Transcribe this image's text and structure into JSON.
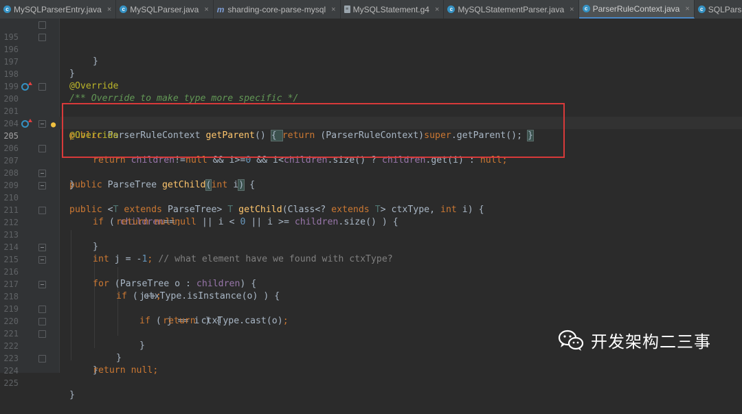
{
  "tabs": [
    {
      "label": "MySQLParserEntry.java",
      "icon": "class-icon",
      "active": false
    },
    {
      "label": "MySQLParser.java",
      "icon": "class-icon",
      "active": false
    },
    {
      "label": "sharding-core-parse-mysql",
      "icon": "maven-module-icon",
      "active": false
    },
    {
      "label": "MySQLStatement.g4",
      "icon": "grammar-file-icon",
      "active": false
    },
    {
      "label": "MySQLStatementParser.java",
      "icon": "class-icon",
      "active": false
    },
    {
      "label": "ParserRuleContext.java",
      "icon": "class-icon",
      "active": true
    },
    {
      "label": "SQLParserEngine.java",
      "icon": "class-icon",
      "active": false
    }
  ],
  "tab_close_glyph": "×",
  "line_numbers": [
    "195",
    "196",
    "197",
    "198",
    "199",
    "200",
    "201",
    "204",
    "205",
    "206",
    "207",
    "208",
    "209",
    "210",
    "211",
    "212",
    "213",
    "214",
    "215",
    "216",
    "217",
    "218",
    "219",
    "220",
    "221",
    "222",
    "223",
    "224",
    "225"
  ],
  "code": {
    "l195": "}",
    "l196": "}",
    "l198": "@Override",
    "l199": "/** Override to make type more specific */",
    "l200_a": "public",
    "l200_b": " ParserRuleContext ",
    "l200_c": "getParent",
    "l200_d": "() ",
    "l200_e": "{ ",
    "l200_f": "return",
    "l200_g": " (ParserRuleContext)",
    "l200_h": "super",
    "l200_i": ".getParent(); ",
    "l200_j": "}",
    "l204": "@Override",
    "l205_a": "public",
    "l205_b": " ParseTree ",
    "l205_c": "getChild",
    "l205_d": "(",
    "l205_e": "int",
    "l205_f": " i",
    "l205_g": ")",
    "l205_h": " {",
    "l206_a": "return ",
    "l206_b": "children",
    "l206_c": "!=",
    "l206_d": "null",
    "l206_e": " && i>=",
    "l206_f": "0",
    "l206_g": " && i<",
    "l206_h": "children",
    "l206_i": ".size() ? ",
    "l206_j": "children",
    "l206_k": ".get(i) : ",
    "l206_l": "null",
    "l206_m": ";",
    "l207": "}",
    "l209_a": "public ",
    "l209_b": "<",
    "l209_c": "T ",
    "l209_d": "extends",
    "l209_e": " ParseTree> ",
    "l209_f": "T ",
    "l209_g": "getChild",
    "l209_h": "(Class<? ",
    "l209_i": "extends ",
    "l209_j": "T",
    "l209_k": "> ctxType, ",
    "l209_l": "int",
    "l209_m": " i) {",
    "l210_a": "if",
    "l210_b": " ( ",
    "l210_c": "children",
    "l210_d": "==",
    "l210_e": "null",
    "l210_f": " || i < ",
    "l210_g": "0",
    "l210_h": " || i >= ",
    "l210_i": "children",
    "l210_j": ".size() ) {",
    "l211_a": "return ",
    "l211_b": "null",
    "l211_c": ";",
    "l212": "}",
    "l214_a": "int",
    "l214_b": " j = -",
    "l214_c": "1",
    "l214_d": "; ",
    "l214_e": "// what element have we found with ctxType?",
    "l215_a": "for",
    "l215_b": " (ParseTree o : ",
    "l215_c": "children",
    "l215_d": ") {",
    "l216_a": "if",
    "l216_b": " ( ctxType.isInstance(o) ) {",
    "l217_a": "j++",
    "l217_b": ";",
    "l218_a": "if",
    "l218_b": " ( j == i ) {",
    "l219_a": "return",
    "l219_b": " ctxType.cast(o)",
    "l219_c": ";",
    "l220": "}",
    "l221": "}",
    "l222": "}",
    "l223_a": "return ",
    "l223_b": "null",
    "l223_c": ";",
    "l224": "}"
  },
  "watermark": {
    "text": "开发架构二三事",
    "icon": "wechat-icon"
  },
  "colors": {
    "background": "#2b2b2b",
    "keyword": "#cc7832",
    "annotation": "#bbb529",
    "method": "#ffc66d",
    "field": "#9876aa",
    "number": "#6897bb",
    "doc_comment": "#629755",
    "highlight_box": "#d93a3a"
  }
}
